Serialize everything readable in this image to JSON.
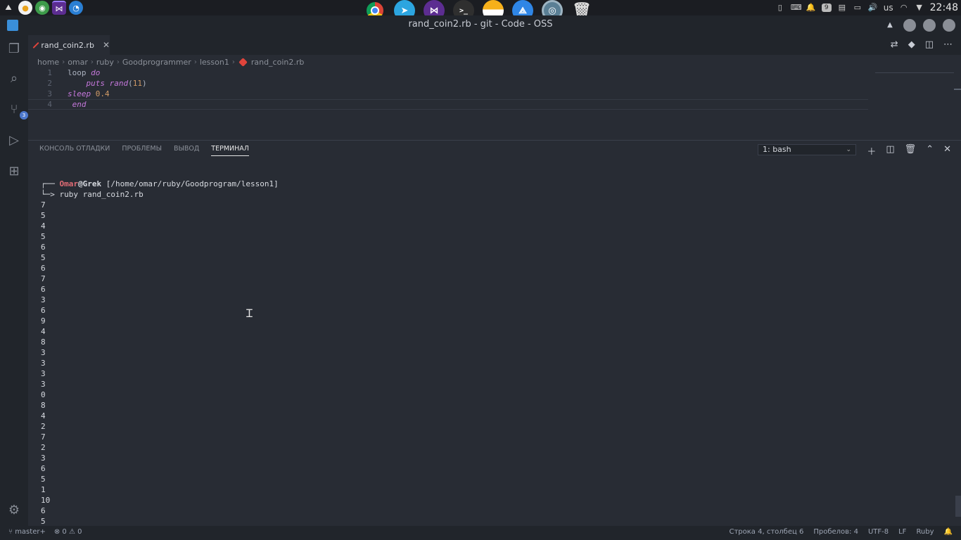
{
  "window": {
    "title": "rand_coin2.rb - git - Code - OSS"
  },
  "system": {
    "keyboard_layout": "us",
    "clock": "22:48",
    "notif_count": "9"
  },
  "tab": {
    "label": "rand_coin2.rb",
    "close_glyph": "✕"
  },
  "breadcrumb": [
    "home",
    "omar",
    "ruby",
    "Goodprogrammer",
    "lesson1",
    "rand_coin2.rb"
  ],
  "editor": {
    "line_numbers": [
      "1",
      "2",
      "3",
      "4"
    ]
  },
  "activity": {
    "scm_badge": "3"
  },
  "panel": {
    "tabs": [
      "КОНСОЛЬ ОТЛАДКИ",
      "ПРОБЛЕМЫ",
      "ВЫВОД",
      "ТЕРМИНАЛ"
    ],
    "terminal_select": "1: bash"
  },
  "terminal": {
    "prompt_prefix": "┌── ",
    "user": "Omar",
    "at": "@",
    "host": "Grek",
    "path": " [/home/omar/ruby/Goodprogram/lesson1]",
    "cmd_prefix": "└─> ",
    "command": "ruby rand_coin2.rb",
    "output": [
      "7",
      "5",
      "4",
      "5",
      "6",
      "5",
      "6",
      "7",
      "6",
      "3",
      "6",
      "9",
      "4",
      "8",
      "3",
      "3",
      "3",
      "3",
      "0",
      "8",
      "4",
      "2",
      "7",
      "2",
      "3",
      "6",
      "5",
      "1",
      "10",
      "6",
      "5"
    ]
  },
  "statusbar": {
    "branch": "master+",
    "errors": "0",
    "warnings": "0",
    "position": "Строка 4, столбец 6",
    "spaces": "Пробелов: 4",
    "encoding": "UTF-8",
    "eol": "LF",
    "language": "Ruby"
  },
  "colors": {
    "bg": "#282c34",
    "chrome": "#21252b",
    "keyword": "#c678dd",
    "number": "#d19a66",
    "prompt_user": "#e06c75"
  }
}
